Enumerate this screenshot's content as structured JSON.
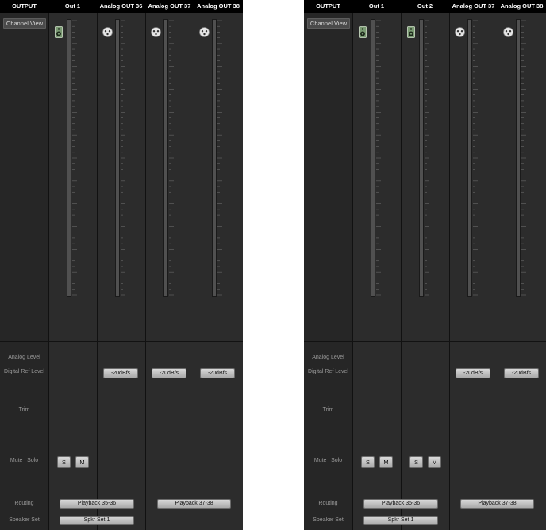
{
  "panels": [
    {
      "header": {
        "label": "OUTPUT",
        "channels": [
          "Out 1",
          "Analog OUT 36",
          "Analog OUT 37",
          "Analog OUT 38"
        ]
      },
      "channel_view_label": "Channel View",
      "icons": [
        "speaker-icon",
        "xlr-icon",
        "xlr-icon",
        "xlr-icon"
      ],
      "row_labels": {
        "analog_level": "Analog Level",
        "digital_ref": "Digital Ref Level",
        "trim": "Trim",
        "mute_solo": "Mute | Solo",
        "routing": "Routing",
        "speaker_set": "Speaker Set"
      },
      "ref_level": [
        "",
        "-20dBfs",
        "-20dBfs",
        "-20dBfs"
      ],
      "solo_label": "S",
      "mute_label": "M",
      "routing": [
        "Playback 35-36",
        "Playback 37-38"
      ],
      "speaker_set": "Spkr Set 1"
    },
    {
      "header": {
        "label": "OUTPUT",
        "channels": [
          "Out 1",
          "Out 2",
          "Analog OUT 37",
          "Analog OUT 38"
        ]
      },
      "channel_view_label": "Channel View",
      "icons": [
        "speaker-icon",
        "speaker-icon",
        "xlr-icon",
        "xlr-icon"
      ],
      "row_labels": {
        "analog_level": "Analog Level",
        "digital_ref": "Digital Ref Level",
        "trim": "Trim",
        "mute_solo": "Mute | Solo",
        "routing": "Routing",
        "speaker_set": "Speaker Set"
      },
      "ref_level": [
        "",
        "",
        "-20dBfs",
        "-20dBfs"
      ],
      "solo_label": "S",
      "mute_label": "M",
      "routing": [
        "Playback 35-36",
        "Playback 37-38"
      ],
      "speaker_set": "Spkr Set 1"
    }
  ],
  "colors": {
    "panel": "#2b2b2b",
    "header": "#000000",
    "button": "#c8c8c8",
    "speaker_icon": "#7a9a72"
  }
}
